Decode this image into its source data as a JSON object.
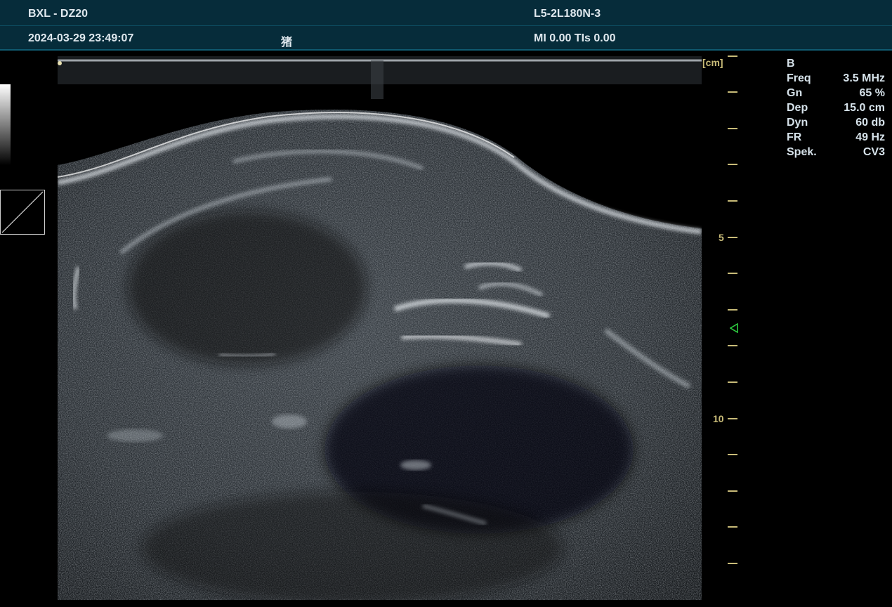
{
  "header": {
    "device": "BXL - DZ20",
    "probe": "L5-2L180N-3",
    "datetime": "2024-03-29 23:49:07",
    "patient": "猪",
    "indices": "MI 0.00 TIs 0.00"
  },
  "ruler": {
    "unit_label": "[cm]",
    "labels": [
      "5",
      "10"
    ]
  },
  "params": {
    "mode": "B",
    "rows": [
      {
        "label": "Freq",
        "value": "3.5 MHz"
      },
      {
        "label": "Gn",
        "value": "65 %"
      },
      {
        "label": "Dep",
        "value": "15.0 cm"
      },
      {
        "label": "Dyn",
        "value": "60 db"
      },
      {
        "label": "FR",
        "value": "49 Hz"
      },
      {
        "label": "Spek.",
        "value": "CV3"
      }
    ]
  },
  "icons": {
    "focus_marker": "triangle-left-icon",
    "gray_map": "grayscale-bar",
    "gamma_curve": "gamma-curve-icon"
  },
  "colors": {
    "header_bg": "#062c3a",
    "ruler": "#c8bb78",
    "focus": "#2ecc40",
    "text": "#d6e2ea"
  }
}
